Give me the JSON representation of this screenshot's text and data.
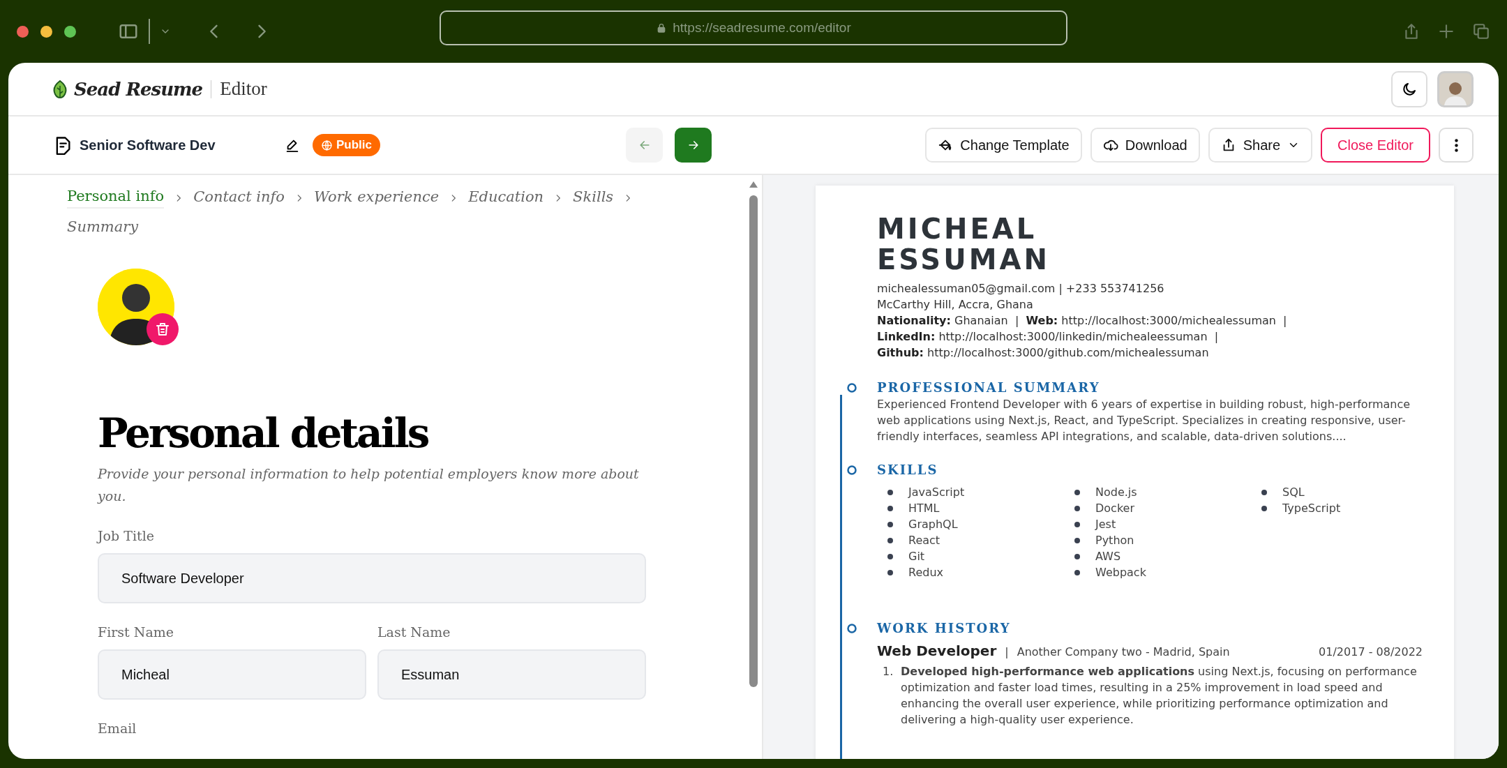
{
  "browser": {
    "url": "https://seadresume.com/editor"
  },
  "header": {
    "logo": "Sead Resume",
    "section": "Editor"
  },
  "toolbar": {
    "resume_title": "Senior Software Dev",
    "visibility": "Public",
    "nav": [
      {
        "kind": "back",
        "disabled": true
      },
      {
        "kind": "forward",
        "disabled": false
      }
    ],
    "actions": [
      {
        "kind": "template",
        "label": "Change Template"
      },
      {
        "kind": "download",
        "label": "Download"
      },
      {
        "kind": "share",
        "label": "Share"
      },
      {
        "kind": "close",
        "label": "Close Editor"
      }
    ]
  },
  "breadcrumbs": [
    {
      "label": "Personal info",
      "selected": true
    },
    {
      "label": "Contact info",
      "selected": false
    },
    {
      "label": "Work experience",
      "selected": false
    },
    {
      "label": "Education",
      "selected": false
    },
    {
      "label": "Skills",
      "selected": false
    },
    {
      "label": "Summary",
      "selected": false
    }
  ],
  "form": {
    "heading": "Personal details",
    "description": "Provide your personal information to help potential employers know more about you.",
    "rows": [
      [
        {
          "label": "Job Title",
          "value": "Software Developer"
        }
      ],
      [
        {
          "label": "First Name",
          "value": "Micheal"
        },
        {
          "label": "Last Name",
          "value": "Essuman"
        }
      ]
    ],
    "next_label": "Email"
  },
  "resume": {
    "name_lines": [
      "MICHEAL",
      "ESSUMAN"
    ],
    "contact_lines": [
      "michealessuman05@gmail.com | +233 553741256",
      "McCarthy Hill, Accra, Ghana",
      "**Nationality:** Ghanaian  |  **Web:** http://localhost:3000/michealessuman  |",
      "**LinkedIn:** http://localhost:3000/linkedin/michealeessuman  |",
      "**Github:** http://localhost:3000/github.com/michealessuman"
    ],
    "summary": {
      "title": "PROFESSIONAL SUMMARY",
      "text": "Experienced Frontend Developer with 6 years of expertise in building robust, high-performance web applications using Next.js, React, and TypeScript. Specializes in creating responsive, user-friendly interfaces, seamless API integrations, and scalable, data-driven solutions...."
    },
    "skills": {
      "title": "SKILLS",
      "items": [
        "JavaScript",
        "HTML",
        "GraphQL",
        "React",
        "Git",
        "Redux",
        "Node.js",
        "Docker",
        "Jest",
        "Python",
        "AWS",
        "Webpack",
        "SQL",
        "TypeScript"
      ]
    },
    "work": {
      "title": "WORK HISTORY",
      "jobs": [
        {
          "role": "Web Developer",
          "separator": "|",
          "company": "Another Company two - Madrid, Spain",
          "dates": "01/2017 - 08/2022",
          "bullets": [
            {
              "number": "1.",
              "text": "**Developed high-performance web applications** using Next.js, focusing on performance optimization and faster load times, resulting in a 25% improvement in load speed and enhancing the overall user experience, while prioritizing performance optimization and delivering a high-quality user experience."
            }
          ]
        }
      ]
    }
  }
}
